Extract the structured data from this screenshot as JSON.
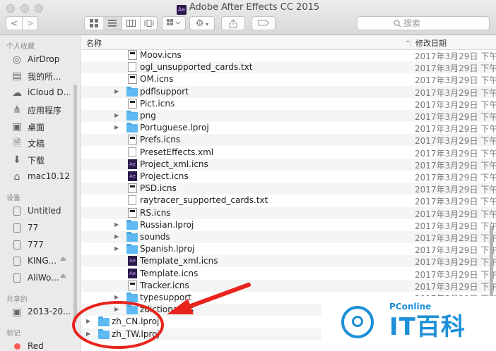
{
  "window": {
    "title": "Adobe After Effects CC 2015",
    "title_icon": "Ae"
  },
  "toolbar": {
    "back_glyph": "<",
    "forward_glyph": ">",
    "search_placeholder": "搜索"
  },
  "sidebar": {
    "favorites_header": "个人收藏",
    "favorites": [
      {
        "label": "AirDrop",
        "icon": "airdrop-icon"
      },
      {
        "label": "我的所...",
        "icon": "all-files-icon"
      },
      {
        "label": "iCloud D...",
        "icon": "cloud-icon"
      },
      {
        "label": "应用程序",
        "icon": "applications-icon"
      },
      {
        "label": "桌面",
        "icon": "desktop-icon"
      },
      {
        "label": "文稿",
        "icon": "documents-icon"
      },
      {
        "label": "下载",
        "icon": "downloads-icon"
      },
      {
        "label": "mac10.12",
        "icon": "home-icon"
      }
    ],
    "devices_header": "设备",
    "devices": [
      {
        "label": "Untitled",
        "eject": false
      },
      {
        "label": "77",
        "eject": false
      },
      {
        "label": "777",
        "eject": false
      },
      {
        "label": "KING...",
        "eject": true
      },
      {
        "label": "AliWo...",
        "eject": true
      }
    ],
    "shared_header": "共享的",
    "shared": [
      {
        "label": "2013-20..."
      }
    ],
    "tags_header": "标记",
    "tags": [
      {
        "label": "Red",
        "color": "#ff5b57"
      }
    ]
  },
  "columns": {
    "name": "名称",
    "date": "修改日期"
  },
  "files": [
    {
      "name": "Moov.icns",
      "type": "icns",
      "depth": 1,
      "expandable": false,
      "date": "2017年3月29日 下午"
    },
    {
      "name": "ogl_unsupported_cards.txt",
      "type": "txt",
      "depth": 1,
      "expandable": false,
      "date": "2017年3月29日 下午"
    },
    {
      "name": "OM.icns",
      "type": "icns",
      "depth": 1,
      "expandable": false,
      "date": "2017年3月29日 下午"
    },
    {
      "name": "pdflsupport",
      "type": "folder",
      "depth": 1,
      "expandable": true,
      "date": "2017年3月29日 下午"
    },
    {
      "name": "Pict.icns",
      "type": "icns",
      "depth": 1,
      "expandable": false,
      "date": "2017年3月29日 下午"
    },
    {
      "name": "png",
      "type": "folder",
      "depth": 1,
      "expandable": true,
      "date": "2017年3月29日 下午"
    },
    {
      "name": "Portuguese.lproj",
      "type": "folder",
      "depth": 1,
      "expandable": true,
      "date": "2017年3月29日 下午"
    },
    {
      "name": "Prefs.icns",
      "type": "icns",
      "depth": 1,
      "expandable": false,
      "date": "2017年3月29日 下午"
    },
    {
      "name": "PresetEffects.xml",
      "type": "txt",
      "depth": 1,
      "expandable": false,
      "date": "2017年3月29日 下午"
    },
    {
      "name": "Project_xml.icns",
      "type": "ae",
      "depth": 1,
      "expandable": false,
      "date": "2017年3月29日 下午"
    },
    {
      "name": "Project.icns",
      "type": "ae",
      "depth": 1,
      "expandable": false,
      "date": "2017年3月29日 下午"
    },
    {
      "name": "PSD.icns",
      "type": "icns",
      "depth": 1,
      "expandable": false,
      "date": "2017年3月29日 下午"
    },
    {
      "name": "raytracer_supported_cards.txt",
      "type": "txt",
      "depth": 1,
      "expandable": false,
      "date": "2017年3月29日 下午"
    },
    {
      "name": "RS.icns",
      "type": "icns",
      "depth": 1,
      "expandable": false,
      "date": "2017年3月29日 下午"
    },
    {
      "name": "Russian.lproj",
      "type": "folder",
      "depth": 1,
      "expandable": true,
      "date": "2017年3月29日 下午"
    },
    {
      "name": "sounds",
      "type": "folder",
      "depth": 1,
      "expandable": true,
      "date": "2017年3月29日 下午"
    },
    {
      "name": "Spanish.lproj",
      "type": "folder",
      "depth": 1,
      "expandable": true,
      "date": "2017年3月29日 下午"
    },
    {
      "name": "Template_xml.icns",
      "type": "ae",
      "depth": 1,
      "expandable": false,
      "date": "2017年3月29日 下午"
    },
    {
      "name": "Template.icns",
      "type": "ae",
      "depth": 1,
      "expandable": false,
      "date": "2017年3月29日 下午"
    },
    {
      "name": "Tracker.icns",
      "type": "icns",
      "depth": 1,
      "expandable": false,
      "date": "2017年3月29日 下午"
    },
    {
      "name": "typesupport",
      "type": "folder",
      "depth": 1,
      "expandable": true,
      "date": "2017年3月29日 下午"
    },
    {
      "name": "zdictionaries",
      "type": "folder",
      "depth": 1,
      "expandable": true,
      "date": "2017年3月29日 下午"
    },
    {
      "name": "zh_CN.lproj",
      "type": "folder",
      "depth": 0,
      "expandable": true,
      "date": ""
    },
    {
      "name": "zh_TW.lproj",
      "type": "folder",
      "depth": 0,
      "expandable": true,
      "date": ""
    }
  ],
  "watermark": {
    "brand": "PConline",
    "name": "IT百科",
    "color": "#1b8fd8"
  },
  "annotation": {
    "color": "#e8241d"
  }
}
